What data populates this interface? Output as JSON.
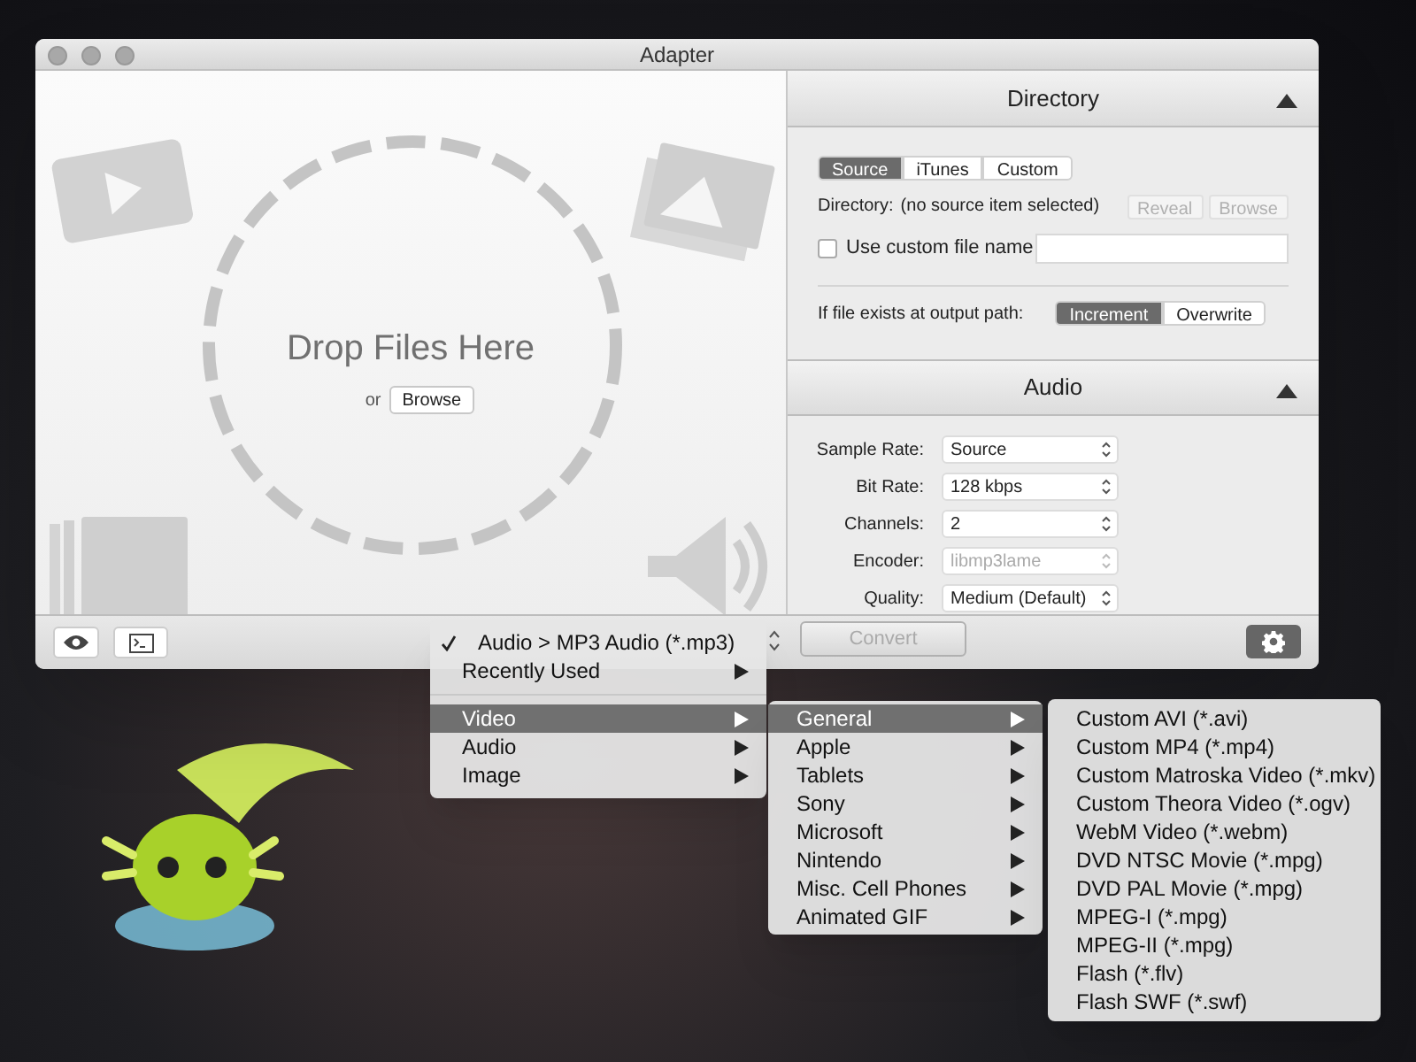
{
  "window": {
    "title": "Adapter"
  },
  "drop_area": {
    "title": "Drop Files Here",
    "or": "or",
    "browse": "Browse"
  },
  "directory_panel": {
    "title": "Directory",
    "expanded": true,
    "source_tabs": [
      {
        "label": "Source",
        "selected": true
      },
      {
        "label": "iTunes",
        "selected": false
      },
      {
        "label": "Custom",
        "selected": false
      }
    ],
    "directory_label": "Directory:",
    "directory_value": "(no source item selected)",
    "buttons": [
      {
        "label": "Reveal",
        "disabled": true
      },
      {
        "label": "Browse",
        "disabled": true
      }
    ],
    "custom_name": {
      "label": "Use custom file name",
      "checked": false
    },
    "conflict": {
      "label": "If file exists at output path:",
      "options": [
        {
          "label": "Increment",
          "selected": true
        },
        {
          "label": "Overwrite",
          "selected": false
        }
      ]
    }
  },
  "audio_panel": {
    "title": "Audio",
    "expanded": true,
    "fields": [
      {
        "label": "Sample Rate:",
        "value": "Source",
        "disabled": false
      },
      {
        "label": "Bit Rate:",
        "value": "128 kbps",
        "disabled": false
      },
      {
        "label": "Channels:",
        "value": "2",
        "disabled": false
      },
      {
        "label": "Encoder:",
        "value": "libmp3lame",
        "disabled": true
      },
      {
        "label": "Quality:",
        "value": "Medium (Default)",
        "disabled": false
      }
    ]
  },
  "toolbar": {
    "convert": {
      "label": "Convert",
      "disabled": true
    }
  },
  "format_menu": {
    "items": [
      {
        "kind": "item",
        "label": "Audio > MP3 Audio (*.mp3)",
        "checked": true,
        "submenu": false,
        "selected": false
      },
      {
        "kind": "item",
        "label": "Recently Used",
        "checked": false,
        "submenu": true,
        "selected": false
      },
      {
        "kind": "separator"
      },
      {
        "kind": "item",
        "label": "Video",
        "checked": false,
        "submenu": true,
        "selected": true
      },
      {
        "kind": "item",
        "label": "Audio",
        "checked": false,
        "submenu": true,
        "selected": false
      },
      {
        "kind": "item",
        "label": "Image",
        "checked": false,
        "submenu": true,
        "selected": false
      }
    ]
  },
  "video_menu": {
    "items": [
      {
        "label": "General",
        "submenu": true,
        "selected": true
      },
      {
        "label": "Apple",
        "submenu": true,
        "selected": false
      },
      {
        "label": "Tablets",
        "submenu": true,
        "selected": false
      },
      {
        "label": "Sony",
        "submenu": true,
        "selected": false
      },
      {
        "label": "Microsoft",
        "submenu": true,
        "selected": false
      },
      {
        "label": "Nintendo",
        "submenu": true,
        "selected": false
      },
      {
        "label": "Misc. Cell Phones",
        "submenu": true,
        "selected": false
      },
      {
        "label": "Animated GIF",
        "submenu": true,
        "selected": false
      }
    ]
  },
  "general_menu": {
    "items": [
      {
        "label": "Custom AVI (*.avi)",
        "selected": false
      },
      {
        "label": "Custom MP4 (*.mp4)",
        "selected": false
      },
      {
        "label": "Custom Matroska Video (*.mkv)",
        "selected": false
      },
      {
        "label": "Custom Theora Video (*.ogv)",
        "selected": false
      },
      {
        "label": "WebM Video (*.webm)",
        "selected": false
      },
      {
        "label": "DVD NTSC Movie (*.mpg)",
        "selected": false
      },
      {
        "label": "DVD PAL Movie (*.mpg)",
        "selected": false
      },
      {
        "label": "MPEG-I (*.mpg)",
        "selected": false
      },
      {
        "label": "MPEG-II (*.mpg)",
        "selected": false
      },
      {
        "label": "Flash (*.flv)",
        "selected": false
      },
      {
        "label": "Flash SWF (*.swf)",
        "selected": false
      }
    ]
  }
}
